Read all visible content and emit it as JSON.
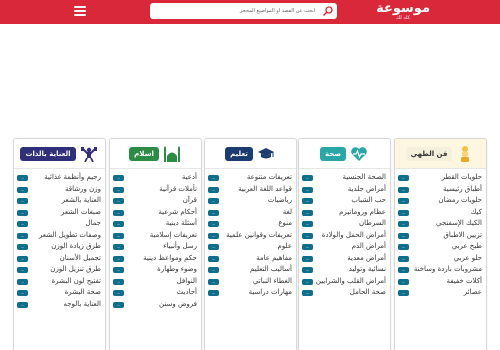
{
  "header": {
    "logo_title": "موسوعة",
    "logo_subtitle": "كله لك",
    "search_placeholder": "ابحث عن القصد أو المواضيع المحجز",
    "background_color": "#d9283a",
    "icons": [
      "search-icon",
      "menu-icon"
    ]
  },
  "colors": {
    "count_badge": "#0f6e8c"
  },
  "panels": [
    {
      "title": "فن الطهي",
      "icon": "chef-icon",
      "header_color": "#fdf6e0",
      "pill_bg": "#f4f0dc",
      "pill_text": "#333333",
      "items": [
        {
          "label": "حلويات القطر",
          "count": "..."
        },
        {
          "label": "أطباق رئيسية",
          "count": "..."
        },
        {
          "label": "حلويات رمضان",
          "count": "..."
        },
        {
          "label": "كيك",
          "count": "..."
        },
        {
          "label": "الكيك الإسفنجي",
          "count": "..."
        },
        {
          "label": "تزيين الاطباق",
          "count": "..."
        },
        {
          "label": "طبخ عربي",
          "count": "..."
        },
        {
          "label": "حلو عربي",
          "count": "..."
        },
        {
          "label": "مشروبات باردة وساخنة",
          "count": "..."
        },
        {
          "label": "أكلات خفيفة",
          "count": "..."
        },
        {
          "label": "عصائر",
          "count": "..."
        }
      ]
    },
    {
      "title": "صحة",
      "icon": "heart-pulse-icon",
      "header_color": "#ffffff",
      "pill_bg": "#2aa6a6",
      "pill_text": "#ffffff",
      "items": [
        {
          "label": "الصحة الجنسية",
          "count": "..."
        },
        {
          "label": "أمراض جلدية",
          "count": "..."
        },
        {
          "label": "حب الشباب",
          "count": "..."
        },
        {
          "label": "عظام وروماتيزم",
          "count": "..."
        },
        {
          "label": "السرطان",
          "count": "..."
        },
        {
          "label": "أمراض الحمل والولادة",
          "count": "..."
        },
        {
          "label": "أمراض الدم",
          "count": "..."
        },
        {
          "label": "أمراض معدية",
          "count": "..."
        },
        {
          "label": "نسائية وتوليد",
          "count": "..."
        },
        {
          "label": "أمراض القلب والشرايين",
          "count": "..."
        },
        {
          "label": "صحة الحامل",
          "count": "..."
        }
      ]
    },
    {
      "title": "تعليم",
      "icon": "graduation-cap-icon",
      "header_color": "#ffffff",
      "pill_bg": "#1c3b6e",
      "pill_text": "#ffffff",
      "items": [
        {
          "label": "تعريفات متنوعة",
          "count": "..."
        },
        {
          "label": "قواعد اللغة العربية",
          "count": "..."
        },
        {
          "label": "رياضيات",
          "count": "..."
        },
        {
          "label": "لغة",
          "count": "..."
        },
        {
          "label": "منوع",
          "count": "..."
        },
        {
          "label": "تعريفات وقوانين علمية",
          "count": "..."
        },
        {
          "label": "علوم",
          "count": "..."
        },
        {
          "label": "مفاهيم عامة",
          "count": "..."
        },
        {
          "label": "أساليب التعليم",
          "count": "..."
        },
        {
          "label": "الغطاء النباتي",
          "count": "..."
        },
        {
          "label": "مهارات دراسية",
          "count": "..."
        }
      ]
    },
    {
      "title": "اسلام",
      "icon": "mosque-icon",
      "header_color": "#ffffff",
      "pill_bg": "#2e8b46",
      "pill_text": "#ffffff",
      "items": [
        {
          "label": "أدعية",
          "count": "..."
        },
        {
          "label": "تأملات قرآنية",
          "count": "..."
        },
        {
          "label": "قرآن",
          "count": "..."
        },
        {
          "label": "أحكام شرعية",
          "count": "..."
        },
        {
          "label": "أسئلة دينية",
          "count": "..."
        },
        {
          "label": "تعريفات إسلامية",
          "count": "..."
        },
        {
          "label": "رسل وأنبياء",
          "count": "..."
        },
        {
          "label": "حكم ومواعظ دينية",
          "count": "..."
        },
        {
          "label": "وضوء وطهارة",
          "count": "..."
        },
        {
          "label": "النوافل",
          "count": "..."
        },
        {
          "label": "أحاديث",
          "count": "..."
        },
        {
          "label": "فروض وسنن",
          "count": "..."
        }
      ]
    },
    {
      "title": "العناية بالذات",
      "icon": "dumbbell-icon",
      "header_color": "#ffffff",
      "pill_bg": "#2f2f7a",
      "pill_text": "#ffffff",
      "items": [
        {
          "label": "رجيم وأنظمة غذائية",
          "count": "..."
        },
        {
          "label": "وزن ورشاقة",
          "count": "..."
        },
        {
          "label": "العناية بالشعر",
          "count": "..."
        },
        {
          "label": "صبغات الشعر",
          "count": "..."
        },
        {
          "label": "جمال",
          "count": "..."
        },
        {
          "label": "وصفات تطويل الشعر",
          "count": "..."
        },
        {
          "label": "طرق زيادة الوزن",
          "count": "..."
        },
        {
          "label": "تجميل الأسنان",
          "count": "..."
        },
        {
          "label": "طرق تنزيل الوزن",
          "count": "..."
        },
        {
          "label": "تفتيح لون البشرة",
          "count": "..."
        },
        {
          "label": "صحة البشرة",
          "count": "..."
        },
        {
          "label": "العناية بالوجه",
          "count": "..."
        }
      ]
    }
  ]
}
